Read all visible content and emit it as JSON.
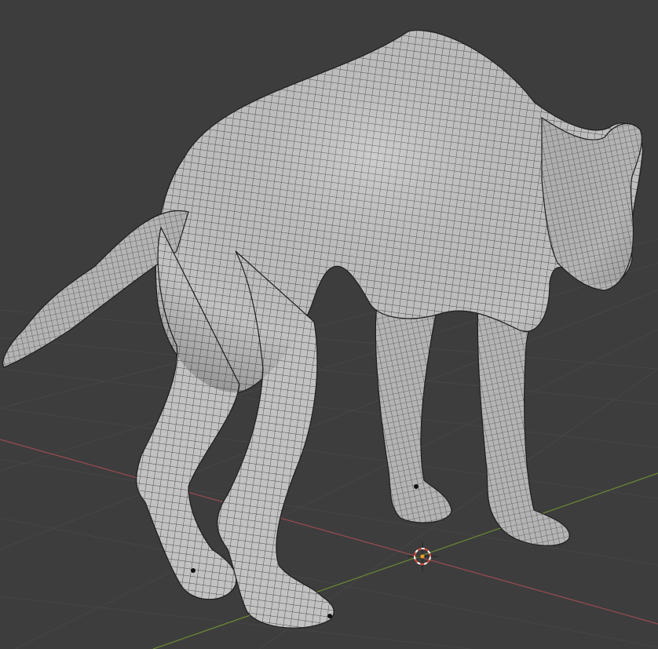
{
  "viewport": {
    "background": "#3d3d3d",
    "grid_color": "#4a4a4a",
    "x_axis_color": "#9a4b51",
    "y_axis_color": "#6b8a35",
    "mesh_fill": "#bdbdbd",
    "mesh_shadow": "#8f8f8f",
    "wire_color": "#2a2a2a"
  },
  "cursor": {
    "ring_colors": [
      "#d84a38",
      "#ffffff"
    ],
    "center_color": "#e8a020"
  },
  "object": {
    "kind": "quad-mesh",
    "subject": "feline-body"
  }
}
